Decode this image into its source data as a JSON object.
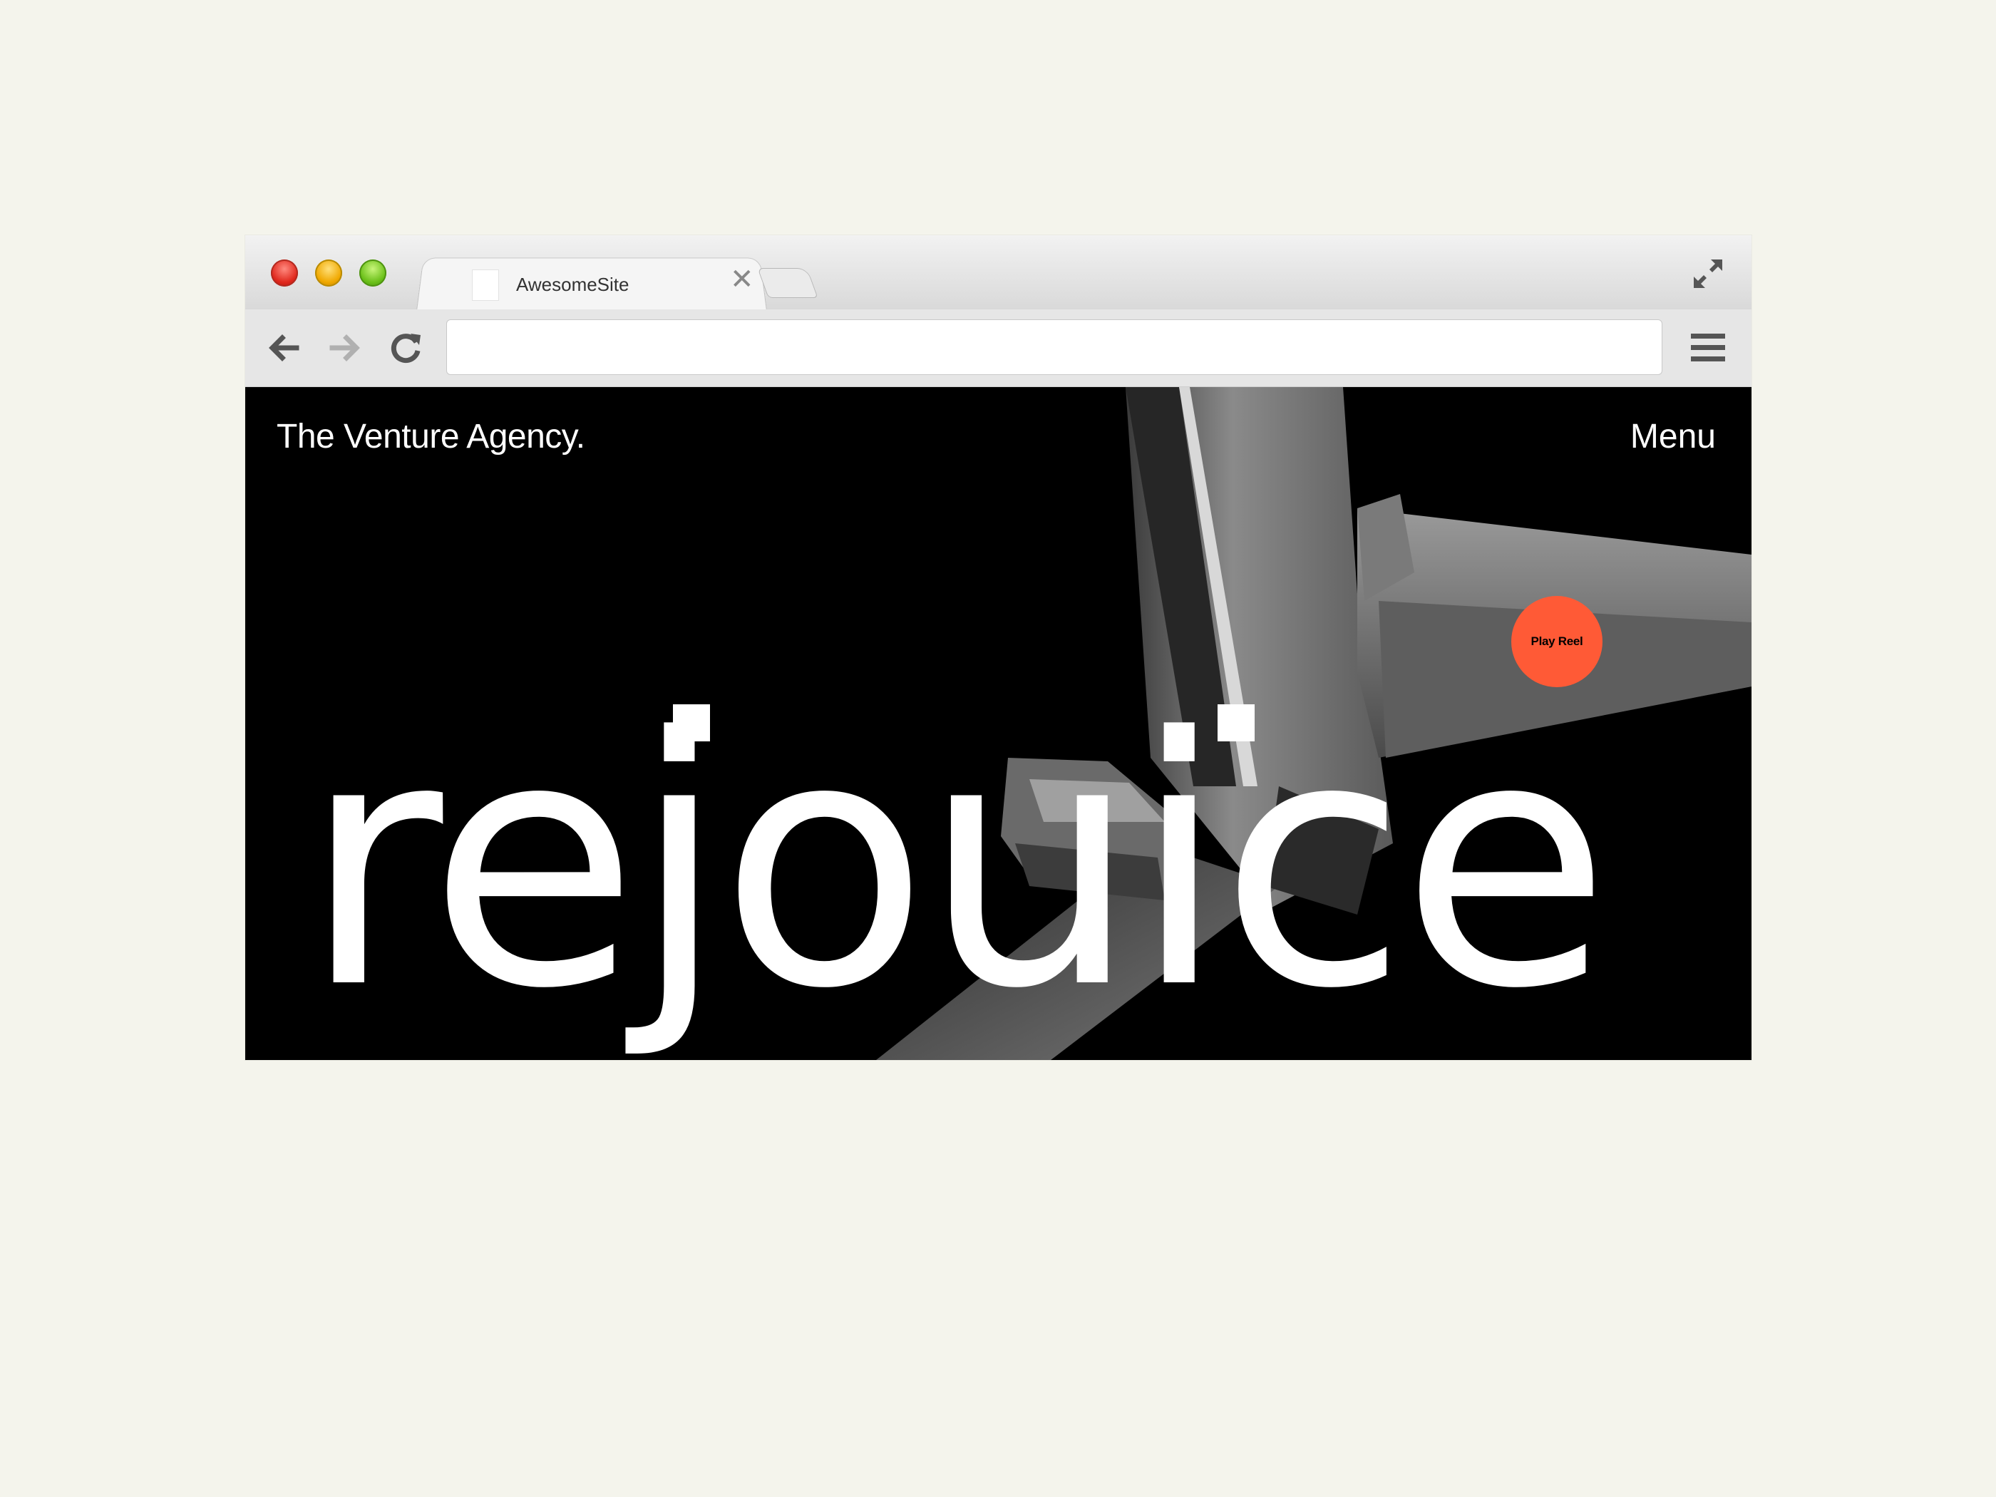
{
  "browser": {
    "tab_title": "AwesomeSite",
    "tab_close": "✕",
    "url_value": ""
  },
  "site": {
    "brand": "The Venture Agency.",
    "menu_label": "Menu",
    "hero_word": "rejouice",
    "play_label": "Play Reel"
  },
  "colors": {
    "accent": "#ff5a36",
    "page_bg": "#f4f4ec",
    "hero_bg": "#000000"
  },
  "icons": [
    "back-arrow-icon",
    "forward-arrow-icon",
    "reload-icon",
    "hamburger-menu-icon",
    "expand-icon",
    "favicon-icon",
    "close-icon"
  ]
}
